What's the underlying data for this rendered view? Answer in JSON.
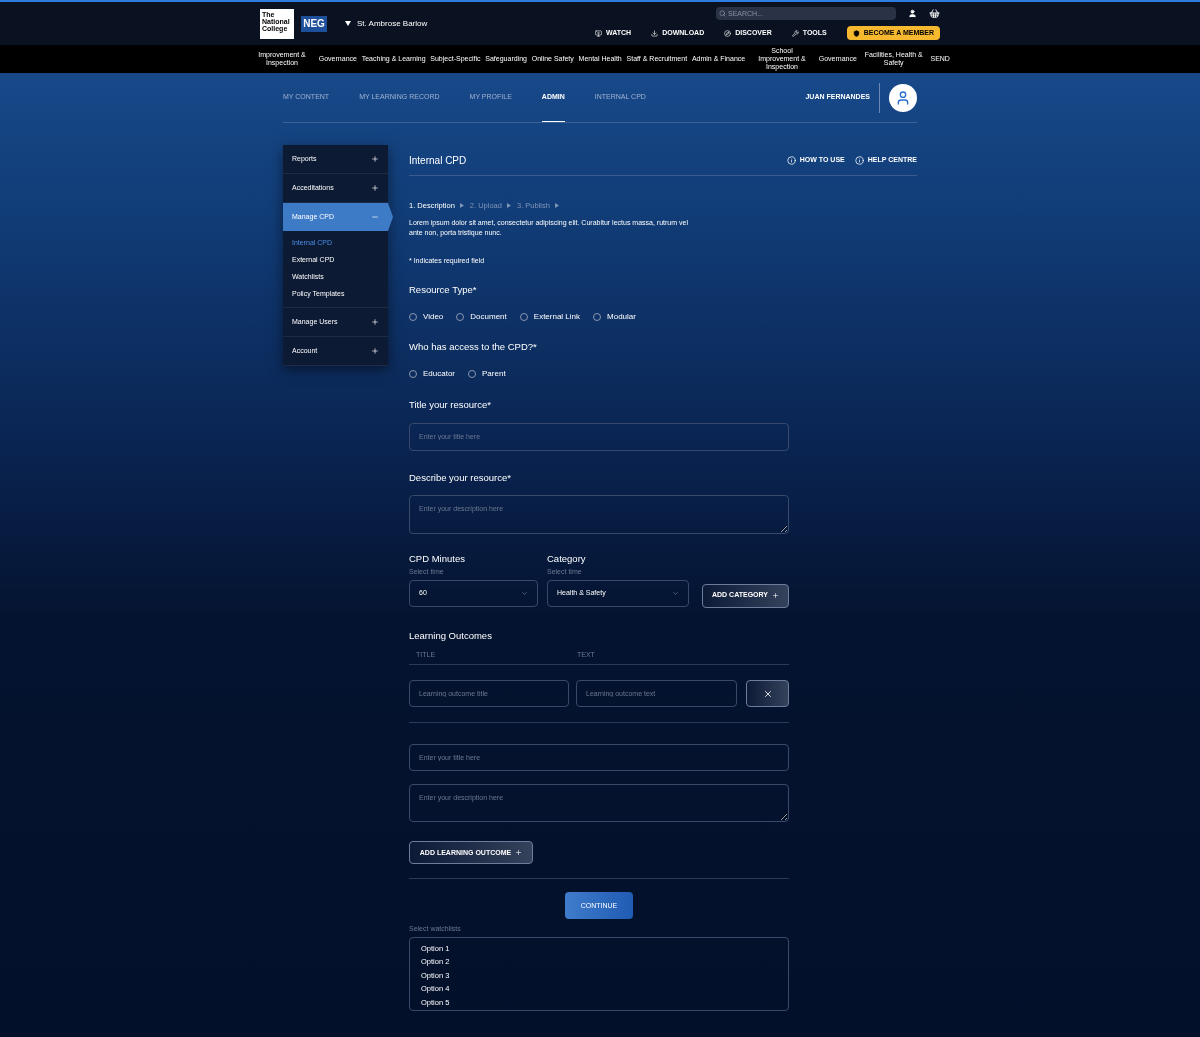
{
  "header": {
    "logo_text": "The National College",
    "brand": "NEG",
    "school": "St. Ambrose Barlow",
    "search": {
      "placeholder": "SEARCH..."
    },
    "actions": [
      {
        "label": "WATCH",
        "kind": "watch"
      },
      {
        "label": "DOWNLOAD",
        "kind": "download"
      },
      {
        "label": "DISCOVER",
        "kind": "discover"
      },
      {
        "label": "TOOLS",
        "kind": "tools"
      }
    ],
    "member_button": "BECOME A MEMBER"
  },
  "nav": [
    "Improvement & Inspection",
    "Governance",
    "Teaching & Learning",
    "Subject-Specific",
    "Safeguarding",
    "Online Safety",
    "Mental Health",
    "Staff & Recruitment",
    "Admin & Finance",
    "School Improvement & Inspection",
    "Governance",
    "Facilities, Health & Safety",
    "SEND"
  ],
  "tabs": [
    {
      "label": "MY CONTENT",
      "selected": false
    },
    {
      "label": "MY LEARNING RECORD",
      "selected": false
    },
    {
      "label": "MY PROFILE",
      "selected": false
    },
    {
      "label": "ADMIN",
      "selected": true
    },
    {
      "label": "INTERNAL CPD",
      "selected": false
    }
  ],
  "user_name": "JUAN FERNANDES",
  "sidebar": [
    {
      "label": "Reports",
      "expanded": false
    },
    {
      "label": "Acceditations",
      "expanded": false
    },
    {
      "label": "Manage CPD",
      "expanded": true,
      "children": [
        {
          "label": "Internal CPD",
          "selected": true
        },
        {
          "label": "External CPD",
          "selected": false
        },
        {
          "label": "Watchlists",
          "selected": false
        },
        {
          "label": "Policy Templates",
          "selected": false
        }
      ]
    },
    {
      "label": "Manage Users",
      "expanded": false
    },
    {
      "label": "Account",
      "expanded": false
    }
  ],
  "page_title": "Internal CPD",
  "help_links": [
    "HOW TO USE",
    "HELP CENTRE"
  ],
  "steps": [
    {
      "label": "1. Description",
      "selected": true
    },
    {
      "label": "2. Upload",
      "selected": false
    },
    {
      "label": "3. Publish",
      "selected": false
    }
  ],
  "intro": "Lorem ipsum dolor sit amet, consectetur adipiscing elit. Curabitur lectus massa, rutrum vel ante non, porta tristique nunc.",
  "required_note": "* Indicates required field",
  "resource_type": {
    "label": "Resource Type*",
    "options": [
      {
        "label": "Video",
        "selected": false
      },
      {
        "label": "Document",
        "selected": false
      },
      {
        "label": "External Link",
        "selected": false
      },
      {
        "label": "Modular",
        "selected": false
      }
    ]
  },
  "access": {
    "label": "Who has access to the CPD?*",
    "options": [
      {
        "label": "Educator",
        "selected": false
      },
      {
        "label": "Parent",
        "selected": false
      }
    ]
  },
  "title_field": {
    "label": "Title your resource*",
    "placeholder": "Enter your title here"
  },
  "description_field": {
    "label": "Describe your resource*",
    "placeholder": "Enter your description here"
  },
  "cpd_minutes": {
    "label": "CPD Minutes",
    "hint": "Select time",
    "value": "60"
  },
  "category": {
    "label": "Category",
    "hint": "Select time",
    "value": "Health & Safety"
  },
  "add_category_button": "ADD CATEGORY",
  "learning_outcomes": {
    "label": "Learning Outcomes",
    "columns": [
      "TITLE",
      "TEXT"
    ],
    "title_placeholder": "Learning outcome title",
    "text_placeholder": "Learning outcome text",
    "new_title_placeholder": "Enter your title here",
    "new_description_placeholder": "Enter your description here",
    "add_button": "ADD LEARNING OUTCOME"
  },
  "continue_button": "CONTINUE",
  "watchlists": {
    "label": "Select watchlists",
    "options": [
      "Option 1",
      "Option 2",
      "Option 3",
      "Option 4",
      "Option 5"
    ]
  }
}
